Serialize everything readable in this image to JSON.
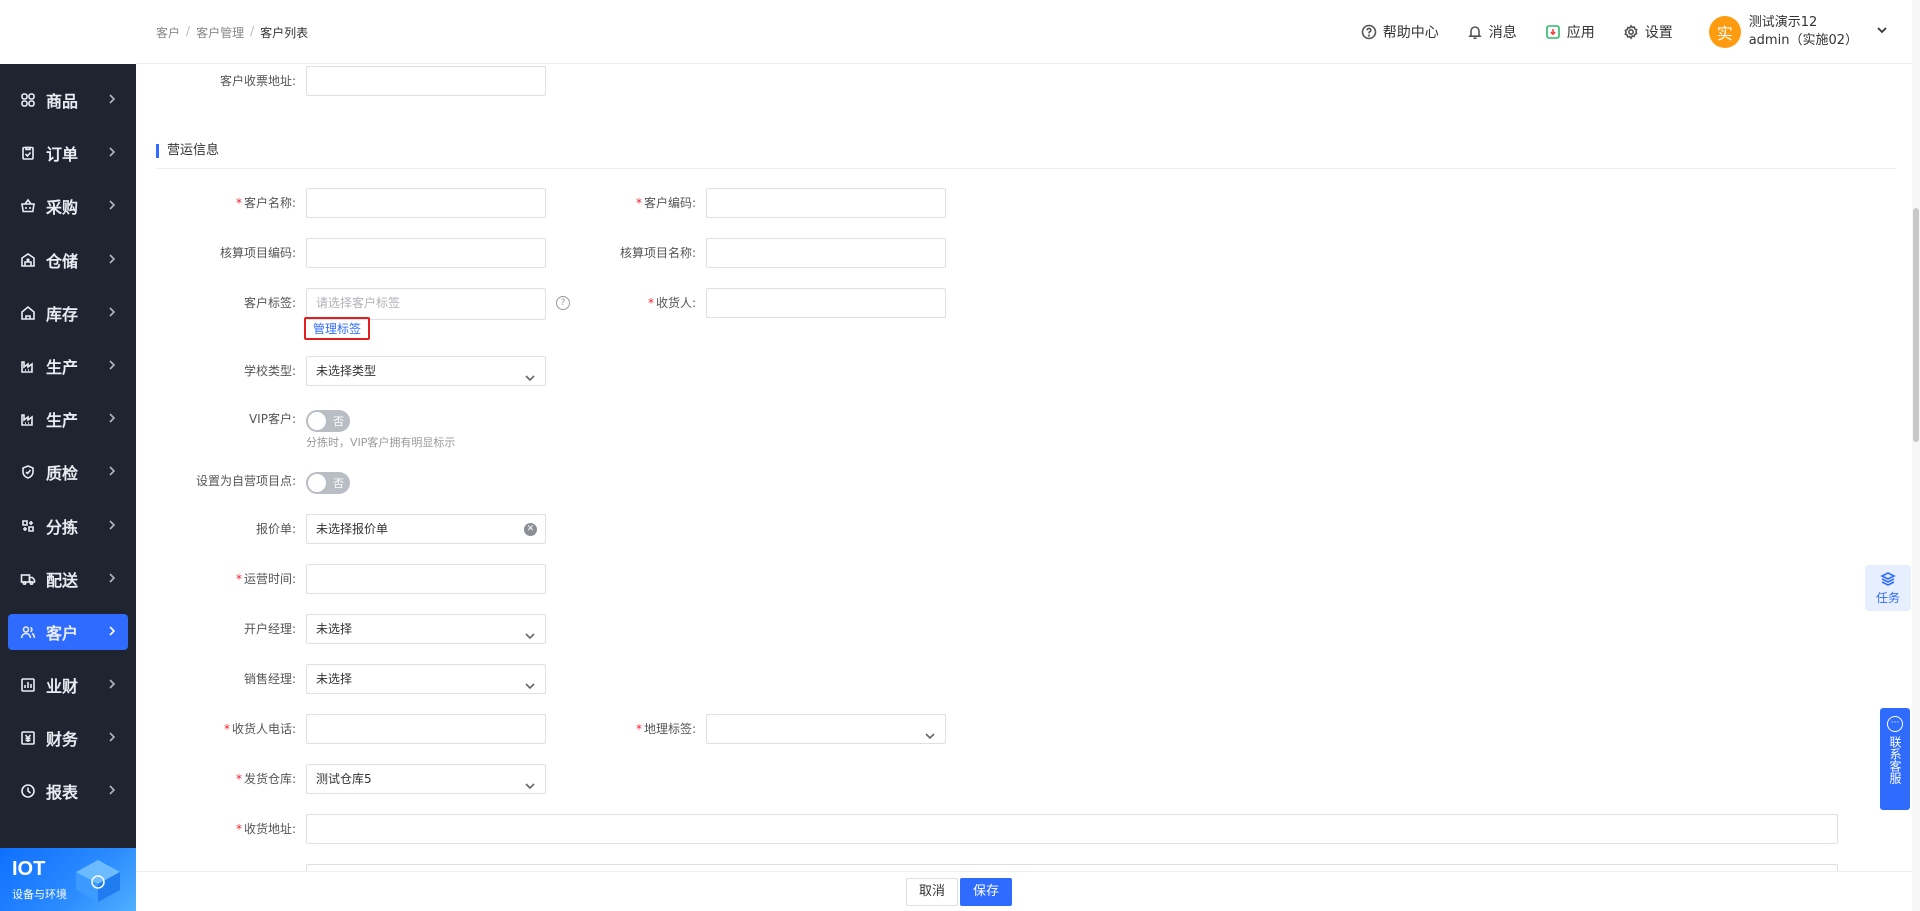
{
  "sidebar": {
    "items": [
      {
        "label": "商品",
        "icon": "grid-icon"
      },
      {
        "label": "订单",
        "icon": "clipboard-icon"
      },
      {
        "label": "采购",
        "icon": "basket-icon"
      },
      {
        "label": "仓储",
        "icon": "warehouse-icon"
      },
      {
        "label": "库存",
        "icon": "home-icon"
      },
      {
        "label": "生产",
        "icon": "factory-icon"
      },
      {
        "label": "生产",
        "icon": "factory-icon"
      },
      {
        "label": "质检",
        "icon": "shield-icon"
      },
      {
        "label": "分拣",
        "icon": "sort-icon"
      },
      {
        "label": "配送",
        "icon": "truck-icon"
      },
      {
        "label": "客户",
        "icon": "users-icon"
      },
      {
        "label": "业财",
        "icon": "chart-icon"
      },
      {
        "label": "财务",
        "icon": "finance-icon"
      },
      {
        "label": "报表",
        "icon": "clock-icon"
      }
    ],
    "active_index": 10,
    "iot": {
      "title": "IOT",
      "subtitle": "设备与环境"
    }
  },
  "header": {
    "breadcrumb": [
      "客户",
      "客户管理",
      "客户列表"
    ],
    "tools": {
      "help": "帮助中心",
      "messages": "消息",
      "apps": "应用",
      "settings": "设置"
    },
    "user": {
      "avatar": "实",
      "name": "测试演示12",
      "account": "admin（实施02）"
    }
  },
  "form": {
    "top_label": "客户收票地址:",
    "section_title": "营运信息",
    "fields": {
      "customer_name_label": "客户名称:",
      "customer_code_label": "客户编码:",
      "acct_code_label": "核算项目编码:",
      "acct_name_label": "核算项目名称:",
      "tag_label": "客户标签:",
      "tag_placeholder": "请选择客户标签",
      "manage_tag": "管理标签",
      "receiver_label": "收货人:",
      "school_type_label": "学校类型:",
      "school_type_value": "未选择类型",
      "vip_label": "VIP客户:",
      "vip_toggle": "否",
      "vip_hint": "分拣时，VIP客户拥有明显标示",
      "self_point_label": "设置为自营项目点:",
      "self_point_toggle": "否",
      "quote_label": "报价单:",
      "quote_value": "未选择报价单",
      "op_time_label": "运营时间:",
      "open_manager_label": "开户经理:",
      "open_manager_value": "未选择",
      "sales_manager_label": "销售经理:",
      "sales_manager_value": "未选择",
      "receiver_phone_label": "收货人电话:",
      "geo_tag_label": "地理标签:",
      "warehouse_label": "发货仓库:",
      "warehouse_value": "测试仓库5",
      "address_label": "收货地址:"
    }
  },
  "buttons": {
    "cancel": "取消",
    "save": "保存"
  },
  "floating": {
    "task": "任务",
    "service": "联系客服"
  },
  "colors": {
    "primary": "#2f6bff",
    "sidebar_bg": "#1f2430",
    "required": "#f5222d",
    "avatar": "#ff9b0f"
  }
}
